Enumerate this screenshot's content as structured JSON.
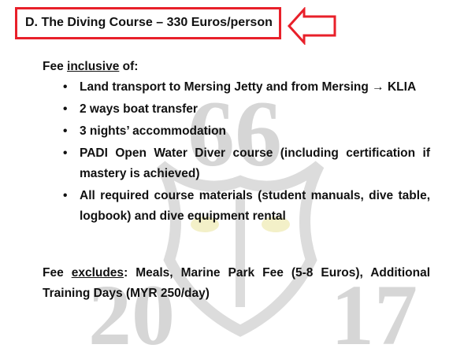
{
  "heading": "D.  The Diving Course – 330 Euros/person",
  "inclusive": {
    "prefix": "Fee ",
    "keyword": "inclusive",
    "suffix": " of:"
  },
  "items": [
    "Land transport to Mersing Jetty and from Mersing → KLIA",
    "2 ways boat transfer",
    "3 nights’ accommodation",
    "PADI Open Water Diver course (including certification if mastery is achieved)",
    "All required course materials (student manuals, dive table, logbook) and dive equipment rental"
  ],
  "excludes": {
    "prefix": "Fee ",
    "keyword": "excludes",
    "suffix": ": Meals, Marine Park Fee (5-8 Euros), Additional Training Days (MYR 250/day)"
  },
  "watermark": {
    "top": "66",
    "bottom_left": "20",
    "bottom_right": "17"
  },
  "colors": {
    "highlight": "#e8202a"
  }
}
